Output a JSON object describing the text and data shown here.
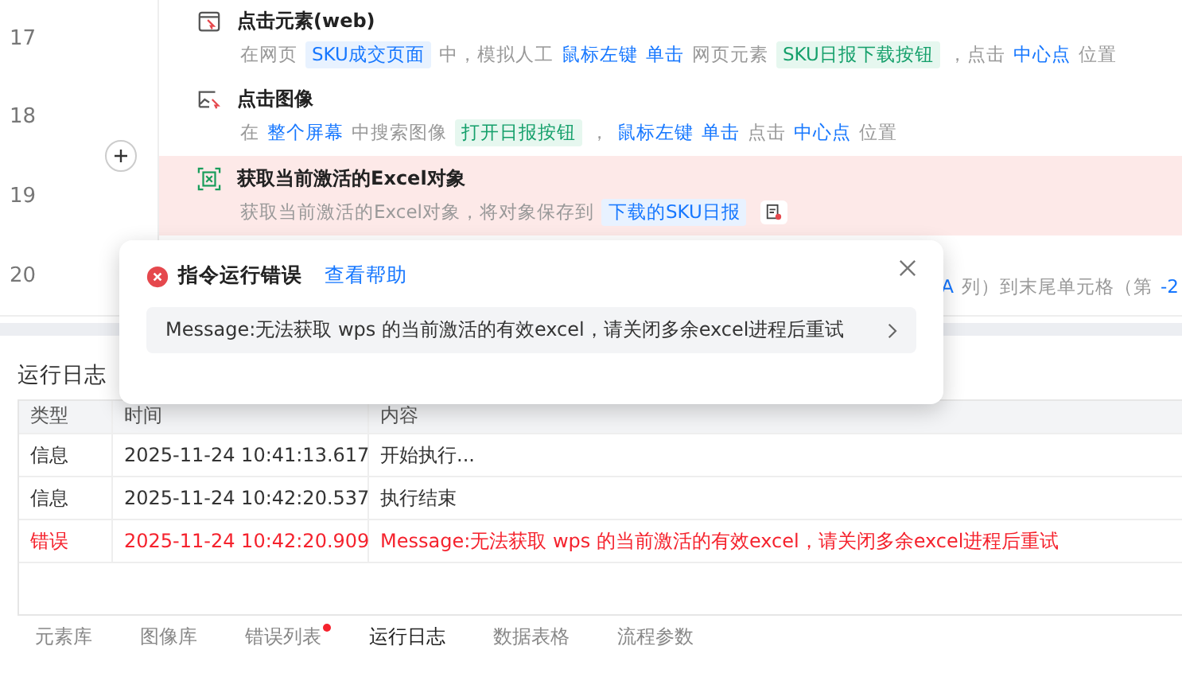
{
  "steps": [
    {
      "number": "17",
      "kind": "web",
      "error": false,
      "title": "点击元素(web)",
      "desc": [
        {
          "kind": "text",
          "text": "在网页"
        },
        {
          "kind": "var",
          "text": "SKU成交页面"
        },
        {
          "kind": "text",
          "text": "中，模拟人工"
        },
        {
          "kind": "keyword",
          "text": "鼠标左键"
        },
        {
          "kind": "keyword",
          "text": "单击"
        },
        {
          "kind": "text",
          "text": "网页元素"
        },
        {
          "kind": "element",
          "text": "SKU日报下载按钮"
        },
        {
          "kind": "text",
          "text": "，点击"
        },
        {
          "kind": "keyword",
          "text": "中心点"
        },
        {
          "kind": "text",
          "text": "位置"
        }
      ]
    },
    {
      "number": "18",
      "kind": "image",
      "error": false,
      "title": "点击图像",
      "desc": [
        {
          "kind": "text",
          "text": "在"
        },
        {
          "kind": "keyword",
          "text": "整个屏幕"
        },
        {
          "kind": "text",
          "text": "中搜索图像"
        },
        {
          "kind": "element",
          "text": "打开日报按钮"
        },
        {
          "kind": "text",
          "text": "，"
        },
        {
          "kind": "keyword",
          "text": "鼠标左键"
        },
        {
          "kind": "keyword",
          "text": "单击"
        },
        {
          "kind": "text",
          "text": "点击"
        },
        {
          "kind": "keyword",
          "text": "中心点"
        },
        {
          "kind": "text",
          "text": "位置"
        }
      ]
    },
    {
      "number": "19",
      "kind": "excel",
      "error": true,
      "title": "获取当前激活的Excel对象",
      "desc": [
        {
          "kind": "text",
          "text": "获取当前激活的Excel对象，将对象保存到"
        },
        {
          "kind": "var",
          "text": "下载的SKU日报"
        }
      ],
      "has_variable_icon": true
    },
    {
      "number": "20",
      "error": false,
      "desc": [
        {
          "kind": "keyword",
          "text": "A"
        },
        {
          "kind": "text",
          "text": "列）到末尾单元格（第"
        },
        {
          "kind": "keyword",
          "text": "-2"
        }
      ]
    }
  ],
  "error_popup": {
    "title": "指令运行错误",
    "help_link": "查看帮助",
    "message": "Message:无法获取 wps 的当前激活的有效excel，请关闭多余excel进程后重试"
  },
  "log": {
    "title": "运行日志",
    "columns": [
      "类型",
      "时间",
      "内容"
    ],
    "rows": [
      {
        "kind": "info",
        "type": "信息",
        "time": "2025-11-24 10:41:13.617",
        "content": "开始执行..."
      },
      {
        "kind": "info",
        "type": "信息",
        "time": "2025-11-24 10:42:20.537",
        "content": "执行结束"
      },
      {
        "kind": "error",
        "type": "错误",
        "time": "2025-11-24 10:42:20.909",
        "content": "Message:无法获取 wps 的当前激活的有效excel，请关闭多余excel进程后重试"
      }
    ]
  },
  "bottom_tabs": [
    {
      "label": "元素库",
      "selected": false,
      "alert": false
    },
    {
      "label": "图像库",
      "selected": false,
      "alert": false
    },
    {
      "label": "错误列表",
      "selected": false,
      "alert": true
    },
    {
      "label": "运行日志",
      "selected": true,
      "alert": false
    },
    {
      "label": "数据表格",
      "selected": false,
      "alert": false
    },
    {
      "label": "流程参数",
      "selected": false,
      "alert": false
    }
  ]
}
